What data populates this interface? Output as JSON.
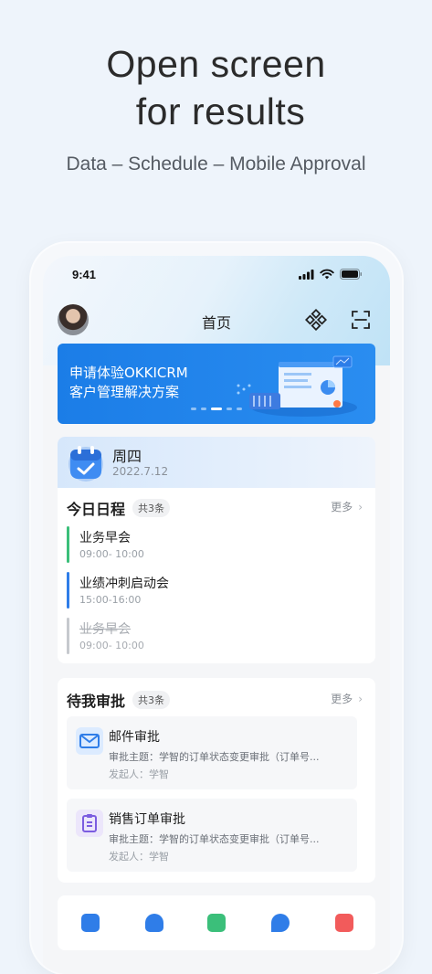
{
  "promo": {
    "headline_line1": "Open screen",
    "headline_line2": "for results",
    "subline": "Data – Schedule – Mobile Approval"
  },
  "status": {
    "time": "9:41"
  },
  "navbar": {
    "title": "首页"
  },
  "banner": {
    "line1": "申请体验OKKICRM",
    "line2": "客户管理解决方案"
  },
  "day": {
    "weekday": "周四",
    "date": "2022.7.12"
  },
  "schedule": {
    "title": "今日日程",
    "count": "共3条",
    "more": "更多",
    "items": [
      {
        "title": "业务早会",
        "time": "09:00- 10:00",
        "color": "#3bbf7a"
      },
      {
        "title": "业绩冲刺启动会",
        "time": "15:00-16:00",
        "color": "#2f7de8"
      },
      {
        "title": "业务早会",
        "time": "09:00- 10:00",
        "color": "#c6c9ce"
      }
    ]
  },
  "approvals": {
    "title": "待我审批",
    "count": "共3条",
    "more": "更多",
    "items": [
      {
        "title": "邮件审批",
        "subject": "审批主题：学智的订单状态变更审批（订单号...",
        "by": "发起人：学智"
      },
      {
        "title": "销售订单审批",
        "subject": "审批主题：学智的订单状态变更审批（订单号...",
        "by": "发起人：学智"
      }
    ]
  },
  "colors": {
    "accent": "#1b7de7",
    "background": "#eef4fb"
  }
}
